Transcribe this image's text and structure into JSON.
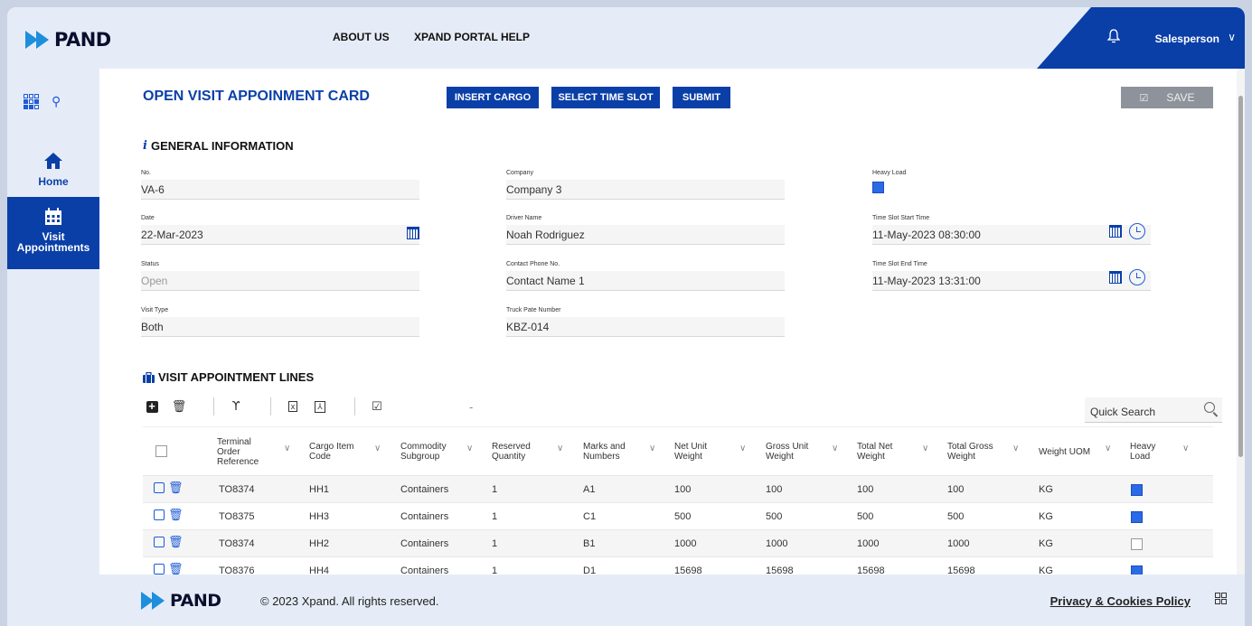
{
  "brand": {
    "logo_text": "PAND"
  },
  "topnav": {
    "about": "ABOUT US",
    "help": "XPAND PORTAL HELP"
  },
  "user": {
    "role": "Salesperson"
  },
  "sidebar": {
    "items": [
      {
        "label": "Home"
      },
      {
        "label_line1": "Visit",
        "label_line2": "Appointments"
      }
    ]
  },
  "page": {
    "title": "OPEN VISIT APPOINMENT CARD",
    "buttons": {
      "insert_cargo": "INSERT CARGO",
      "select_time_slot": "SELECT TIME SLOT",
      "submit": "SUBMIT",
      "save": "SAVE"
    }
  },
  "general": {
    "title": "GENERAL INFORMATION",
    "no": {
      "label": "No.",
      "value": "VA-6"
    },
    "date": {
      "label": "Date",
      "value": "22-Mar-2023"
    },
    "status": {
      "label": "Status",
      "value": "Open"
    },
    "visit_type": {
      "label": "Visit Type",
      "value": "Both"
    },
    "company": {
      "label": "Company",
      "value": "Company 3"
    },
    "driver": {
      "label": "Driver Name",
      "value": "Noah Rodriguez"
    },
    "contact": {
      "label": "Contact Phone No.",
      "value": "Contact Name 1"
    },
    "truck": {
      "label": "Truck Pate Number",
      "value": "KBZ-014"
    },
    "heavy": {
      "label": "Heavy Load",
      "checked": true
    },
    "start": {
      "label": "Time Slot Start Time",
      "value": "11-May-2023 08:30:00"
    },
    "end": {
      "label": "Time Slot End Time",
      "value": "11-May-2023 13:31:00"
    }
  },
  "lines": {
    "title": "VISIT APPOINTMENT LINES",
    "quick_search_placeholder": "Quick Search",
    "dash": "-",
    "columns": [
      {
        "line1": "Terminal",
        "line2": "Order",
        "line3": "Reference"
      },
      {
        "line1": "Cargo Item",
        "line2": "Code",
        "line3": ""
      },
      {
        "line1": "Commodity",
        "line2": "Subgroup",
        "line3": ""
      },
      {
        "line1": "Reserved",
        "line2": "Quantity",
        "line3": ""
      },
      {
        "line1": "Marks and",
        "line2": "Numbers",
        "line3": ""
      },
      {
        "line1": "Net Unit",
        "line2": "Weight",
        "line3": ""
      },
      {
        "line1": "Gross Unit",
        "line2": "Weight",
        "line3": ""
      },
      {
        "line1": "Total Net",
        "line2": "Weight",
        "line3": ""
      },
      {
        "line1": "Total Gross",
        "line2": "Weight",
        "line3": ""
      },
      {
        "line1": "Weight UOM",
        "line2": "",
        "line3": ""
      },
      {
        "line1": "Heavy",
        "line2": "Load",
        "line3": ""
      }
    ],
    "rows": [
      {
        "ref": "TO8374",
        "code": "HH1",
        "subgroup": "Containers",
        "qty": "1",
        "marks": "A1",
        "net": "100",
        "gross": "100",
        "tnet": "100",
        "tgross": "100",
        "uom": "KG",
        "heavy": true
      },
      {
        "ref": "TO8375",
        "code": "HH3",
        "subgroup": "Containers",
        "qty": "1",
        "marks": "C1",
        "net": "500",
        "gross": "500",
        "tnet": "500",
        "tgross": "500",
        "uom": "KG",
        "heavy": true
      },
      {
        "ref": "TO8374",
        "code": "HH2",
        "subgroup": "Containers",
        "qty": "1",
        "marks": "B1",
        "net": "1000",
        "gross": "1000",
        "tnet": "1000",
        "tgross": "1000",
        "uom": "KG",
        "heavy": false
      },
      {
        "ref": "TO8376",
        "code": "HH4",
        "subgroup": "Containers",
        "qty": "1",
        "marks": "D1",
        "net": "15698",
        "gross": "15698",
        "tnet": "15698",
        "tgross": "15698",
        "uom": "KG",
        "heavy": true
      }
    ]
  },
  "footer": {
    "copyright": "© 2023 Xpand. All rights reserved.",
    "privacy": "Privacy & Cookies Policy"
  },
  "colors": {
    "brand_blue": "#0a3fa8",
    "accent_blue": "#1e5bd6",
    "logo_chevron": "#1d8fdc",
    "save_grey": "#8e939b"
  },
  "icons": [
    "bell-icon",
    "chevron-down-icon",
    "apps-grid-icon",
    "pin-icon",
    "home-icon",
    "calendar-icon",
    "info-icon",
    "briefcase-icon",
    "plus-icon",
    "trash-icon",
    "clear-filter-icon",
    "excel-icon",
    "pdf-icon",
    "check-square-icon",
    "search-icon",
    "clock-icon",
    "qr-icon"
  ]
}
